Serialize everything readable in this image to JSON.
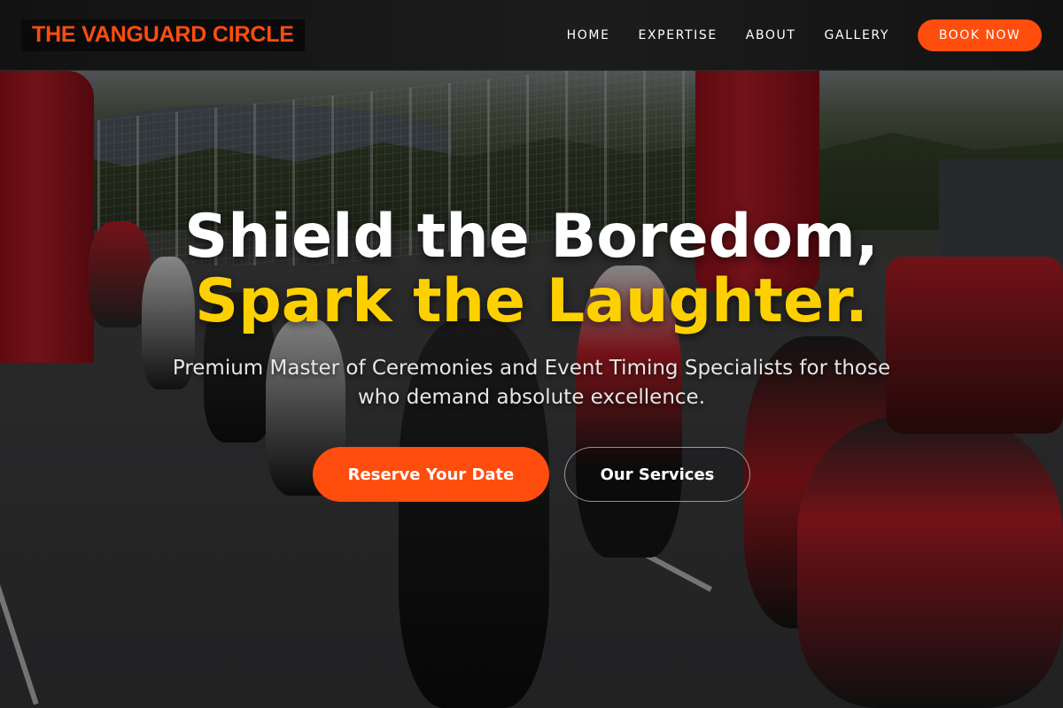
{
  "header": {
    "logo_text": "THE VANGUARD CIRCLE",
    "nav": [
      {
        "label": "HOME"
      },
      {
        "label": "EXPERTISE"
      },
      {
        "label": "ABOUT"
      },
      {
        "label": "GALLERY"
      }
    ],
    "book_label": "BOOK NOW"
  },
  "hero": {
    "headline_line1": "Shield the Boredom,",
    "headline_line2": "Spark the Laughter.",
    "subtitle": "Premium Master of Ceremonies and Event Timing Specialists for those who demand absolute excellence.",
    "primary_cta": "Reserve Your Date",
    "secondary_cta": "Our Services",
    "background_description_icon": "motorcycle-race-grid-photo"
  },
  "colors": {
    "accent": "#ff4d0e",
    "highlight": "#ffd000",
    "text": "#ffffff"
  }
}
